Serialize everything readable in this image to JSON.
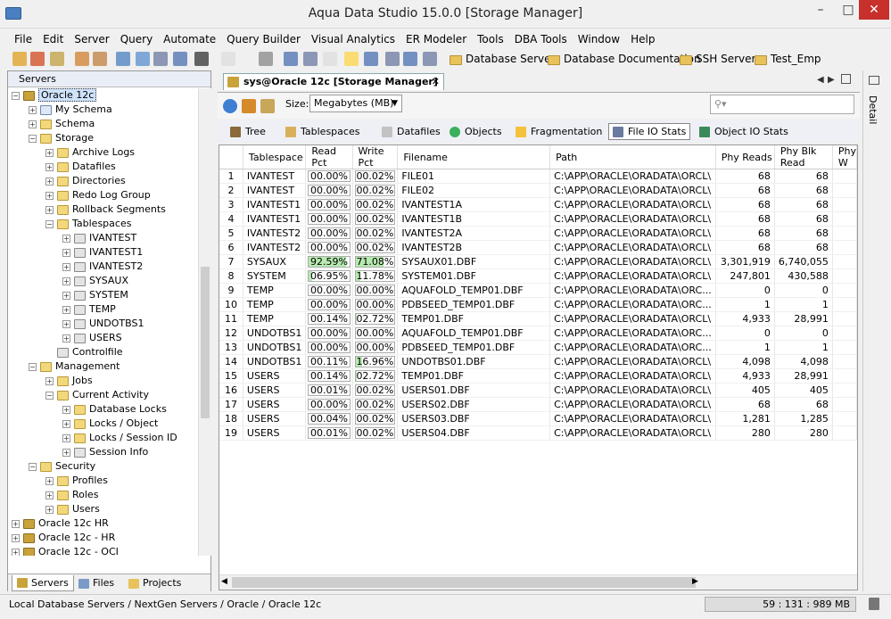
{
  "window": {
    "title": "Aqua Data Studio 15.0.0 [Storage Manager]"
  },
  "menu": [
    "File",
    "Edit",
    "Server",
    "Query",
    "Automate",
    "Query Builder",
    "Visual Analytics",
    "ER Modeler",
    "Tools",
    "DBA Tools",
    "Window",
    "Help"
  ],
  "toolbar": {
    "links": [
      "Database Servers",
      "Database Documentation",
      "SSH Servers",
      "Test_Emp"
    ]
  },
  "left": {
    "header": "Servers",
    "tree": [
      {
        "label": "Oracle 12c",
        "depth": 0,
        "exp": "-",
        "icon": "db",
        "selected": true
      },
      {
        "label": "My Schema",
        "depth": 1,
        "exp": "+",
        "icon": "schema"
      },
      {
        "label": "Schema",
        "depth": 1,
        "exp": "+",
        "icon": "folder"
      },
      {
        "label": "Storage",
        "depth": 1,
        "exp": "-",
        "icon": "folder"
      },
      {
        "label": "Archive Logs",
        "depth": 2,
        "exp": "+",
        "icon": "folder"
      },
      {
        "label": "Datafiles",
        "depth": 2,
        "exp": "+",
        "icon": "folder"
      },
      {
        "label": "Directories",
        "depth": 2,
        "exp": "+",
        "icon": "folder"
      },
      {
        "label": "Redo Log Group",
        "depth": 2,
        "exp": "+",
        "icon": "folder"
      },
      {
        "label": "Rollback Segments",
        "depth": 2,
        "exp": "+",
        "icon": "folder"
      },
      {
        "label": "Tablespaces",
        "depth": 2,
        "exp": "-",
        "icon": "folder"
      },
      {
        "label": "IVANTEST",
        "depth": 3,
        "exp": "+",
        "icon": "ts"
      },
      {
        "label": "IVANTEST1",
        "depth": 3,
        "exp": "+",
        "icon": "ts"
      },
      {
        "label": "IVANTEST2",
        "depth": 3,
        "exp": "+",
        "icon": "ts"
      },
      {
        "label": "SYSAUX",
        "depth": 3,
        "exp": "+",
        "icon": "ts"
      },
      {
        "label": "SYSTEM",
        "depth": 3,
        "exp": "+",
        "icon": "ts"
      },
      {
        "label": "TEMP",
        "depth": 3,
        "exp": "+",
        "icon": "ts"
      },
      {
        "label": "UNDOTBS1",
        "depth": 3,
        "exp": "+",
        "icon": "ts"
      },
      {
        "label": "USERS",
        "depth": 3,
        "exp": "+",
        "icon": "ts"
      },
      {
        "label": "Controlfile",
        "depth": 2,
        "exp": "",
        "icon": "ts"
      },
      {
        "label": "Management",
        "depth": 1,
        "exp": "-",
        "icon": "folder"
      },
      {
        "label": "Jobs",
        "depth": 2,
        "exp": "+",
        "icon": "folder"
      },
      {
        "label": "Current Activity",
        "depth": 2,
        "exp": "-",
        "icon": "folder"
      },
      {
        "label": "Database Locks",
        "depth": 3,
        "exp": "+",
        "icon": "folder"
      },
      {
        "label": "Locks / Object",
        "depth": 3,
        "exp": "+",
        "icon": "folder"
      },
      {
        "label": "Locks / Session ID",
        "depth": 3,
        "exp": "+",
        "icon": "folder"
      },
      {
        "label": "Session Info",
        "depth": 3,
        "exp": "+",
        "icon": "ts"
      },
      {
        "label": "Security",
        "depth": 1,
        "exp": "-",
        "icon": "folder"
      },
      {
        "label": "Profiles",
        "depth": 2,
        "exp": "+",
        "icon": "folder"
      },
      {
        "label": "Roles",
        "depth": 2,
        "exp": "+",
        "icon": "folder"
      },
      {
        "label": "Users",
        "depth": 2,
        "exp": "+",
        "icon": "folder"
      },
      {
        "label": "Oracle 12c HR",
        "depth": 0,
        "exp": "+",
        "icon": "db"
      },
      {
        "label": "Oracle 12c - HR",
        "depth": 0,
        "exp": "+",
        "icon": "db"
      },
      {
        "label": "Oracle 12c - OCI",
        "depth": 0,
        "exp": "+",
        "icon": "db"
      }
    ],
    "tabs": [
      "Servers",
      "Files",
      "Projects"
    ]
  },
  "main": {
    "doc_tab": "sys@Oracle 12c [Storage Manager]",
    "size_label": "Size:",
    "size_value": "Megabytes (MB)",
    "view_tabs": [
      "Tree",
      "Tablespaces",
      "Datafiles",
      "Objects",
      "Fragmentation",
      "File IO Stats",
      "Object IO Stats"
    ],
    "active_view": 5,
    "columns": [
      "Tablespace",
      "Read Pct",
      "Write Pct",
      "Filename",
      "Path",
      "Phy Reads",
      "Phy Blk Read",
      "Phy W"
    ],
    "rows": [
      {
        "n": "1",
        "ts": "IVANTEST",
        "rp": "00.00%",
        "rpv": 0,
        "wp": "00.02%",
        "wpv": 0.02,
        "fn": "FILE01",
        "path": "C:\\APP\\ORACLE\\ORADATA\\ORCL\\",
        "pr": "68",
        "pbr": "68"
      },
      {
        "n": "2",
        "ts": "IVANTEST",
        "rp": "00.00%",
        "rpv": 0,
        "wp": "00.02%",
        "wpv": 0.02,
        "fn": "FILE02",
        "path": "C:\\APP\\ORACLE\\ORADATA\\ORCL\\",
        "pr": "68",
        "pbr": "68"
      },
      {
        "n": "3",
        "ts": "IVANTEST1",
        "rp": "00.00%",
        "rpv": 0,
        "wp": "00.02%",
        "wpv": 0.02,
        "fn": "IVANTEST1A",
        "path": "C:\\APP\\ORACLE\\ORADATA\\ORCL\\",
        "pr": "68",
        "pbr": "68"
      },
      {
        "n": "4",
        "ts": "IVANTEST1",
        "rp": "00.00%",
        "rpv": 0,
        "wp": "00.02%",
        "wpv": 0.02,
        "fn": "IVANTEST1B",
        "path": "C:\\APP\\ORACLE\\ORADATA\\ORCL\\",
        "pr": "68",
        "pbr": "68"
      },
      {
        "n": "5",
        "ts": "IVANTEST2",
        "rp": "00.00%",
        "rpv": 0,
        "wp": "00.02%",
        "wpv": 0.02,
        "fn": "IVANTEST2A",
        "path": "C:\\APP\\ORACLE\\ORADATA\\ORCL\\",
        "pr": "68",
        "pbr": "68"
      },
      {
        "n": "6",
        "ts": "IVANTEST2",
        "rp": "00.00%",
        "rpv": 0,
        "wp": "00.02%",
        "wpv": 0.02,
        "fn": "IVANTEST2B",
        "path": "C:\\APP\\ORACLE\\ORADATA\\ORCL\\",
        "pr": "68",
        "pbr": "68"
      },
      {
        "n": "7",
        "ts": "SYSAUX",
        "rp": "92.59%",
        "rpv": 92.59,
        "wp": "71.08%",
        "wpv": 71.08,
        "fn": "SYSAUX01.DBF",
        "path": "C:\\APP\\ORACLE\\ORADATA\\ORCL\\",
        "pr": "3,301,919",
        "pbr": "6,740,055"
      },
      {
        "n": "8",
        "ts": "SYSTEM",
        "rp": "06.95%",
        "rpv": 6.95,
        "wp": "11.78%",
        "wpv": 11.78,
        "fn": "SYSTEM01.DBF",
        "path": "C:\\APP\\ORACLE\\ORADATA\\ORCL\\",
        "pr": "247,801",
        "pbr": "430,588"
      },
      {
        "n": "9",
        "ts": "TEMP",
        "rp": "00.00%",
        "rpv": 0,
        "wp": "00.00%",
        "wpv": 0,
        "fn": "AQUAFOLD_TEMP01.DBF",
        "path": "C:\\APP\\ORACLE\\ORADATA\\ORC...",
        "pr": "0",
        "pbr": "0"
      },
      {
        "n": "10",
        "ts": "TEMP",
        "rp": "00.00%",
        "rpv": 0,
        "wp": "00.00%",
        "wpv": 0,
        "fn": "PDBSEED_TEMP01.DBF",
        "path": "C:\\APP\\ORACLE\\ORADATA\\ORC...",
        "pr": "1",
        "pbr": "1"
      },
      {
        "n": "11",
        "ts": "TEMP",
        "rp": "00.14%",
        "rpv": 0.14,
        "wp": "02.72%",
        "wpv": 2.72,
        "fn": "TEMP01.DBF",
        "path": "C:\\APP\\ORACLE\\ORADATA\\ORCL\\",
        "pr": "4,933",
        "pbr": "28,991"
      },
      {
        "n": "12",
        "ts": "UNDOTBS1",
        "rp": "00.00%",
        "rpv": 0,
        "wp": "00.00%",
        "wpv": 0,
        "fn": "AQUAFOLD_TEMP01.DBF",
        "path": "C:\\APP\\ORACLE\\ORADATA\\ORC...",
        "pr": "0",
        "pbr": "0"
      },
      {
        "n": "13",
        "ts": "UNDOTBS1",
        "rp": "00.00%",
        "rpv": 0,
        "wp": "00.00%",
        "wpv": 0,
        "fn": "PDBSEED_TEMP01.DBF",
        "path": "C:\\APP\\ORACLE\\ORADATA\\ORC...",
        "pr": "1",
        "pbr": "1"
      },
      {
        "n": "14",
        "ts": "UNDOTBS1",
        "rp": "00.11%",
        "rpv": 0.11,
        "wp": "16.96%",
        "wpv": 16.96,
        "fn": "UNDOTBS01.DBF",
        "path": "C:\\APP\\ORACLE\\ORADATA\\ORCL\\",
        "pr": "4,098",
        "pbr": "4,098"
      },
      {
        "n": "15",
        "ts": "USERS",
        "rp": "00.14%",
        "rpv": 0.14,
        "wp": "02.72%",
        "wpv": 2.72,
        "fn": "TEMP01.DBF",
        "path": "C:\\APP\\ORACLE\\ORADATA\\ORCL\\",
        "pr": "4,933",
        "pbr": "28,991"
      },
      {
        "n": "16",
        "ts": "USERS",
        "rp": "00.01%",
        "rpv": 0.01,
        "wp": "00.02%",
        "wpv": 0.02,
        "fn": "USERS01.DBF",
        "path": "C:\\APP\\ORACLE\\ORADATA\\ORCL\\",
        "pr": "405",
        "pbr": "405"
      },
      {
        "n": "17",
        "ts": "USERS",
        "rp": "00.00%",
        "rpv": 0,
        "wp": "00.02%",
        "wpv": 0.02,
        "fn": "USERS02.DBF",
        "path": "C:\\APP\\ORACLE\\ORADATA\\ORCL\\",
        "pr": "68",
        "pbr": "68"
      },
      {
        "n": "18",
        "ts": "USERS",
        "rp": "00.04%",
        "rpv": 0.04,
        "wp": "00.02%",
        "wpv": 0.02,
        "fn": "USERS03.DBF",
        "path": "C:\\APP\\ORACLE\\ORADATA\\ORCL\\",
        "pr": "1,281",
        "pbr": "1,285"
      },
      {
        "n": "19",
        "ts": "USERS",
        "rp": "00.01%",
        "rpv": 0.01,
        "wp": "00.02%",
        "wpv": 0.02,
        "fn": "USERS04.DBF",
        "path": "C:\\APP\\ORACLE\\ORADATA\\ORCL\\",
        "pr": "280",
        "pbr": "280"
      }
    ]
  },
  "right": {
    "detail_label": "Detail"
  },
  "status": {
    "path": "Local Database Servers / NextGen Servers / Oracle / Oracle 12c",
    "memory": "59 : 131 : 989 MB"
  },
  "colors": {
    "bar_fill": "#b7eab0",
    "selected_node": "#cfe3fb"
  }
}
